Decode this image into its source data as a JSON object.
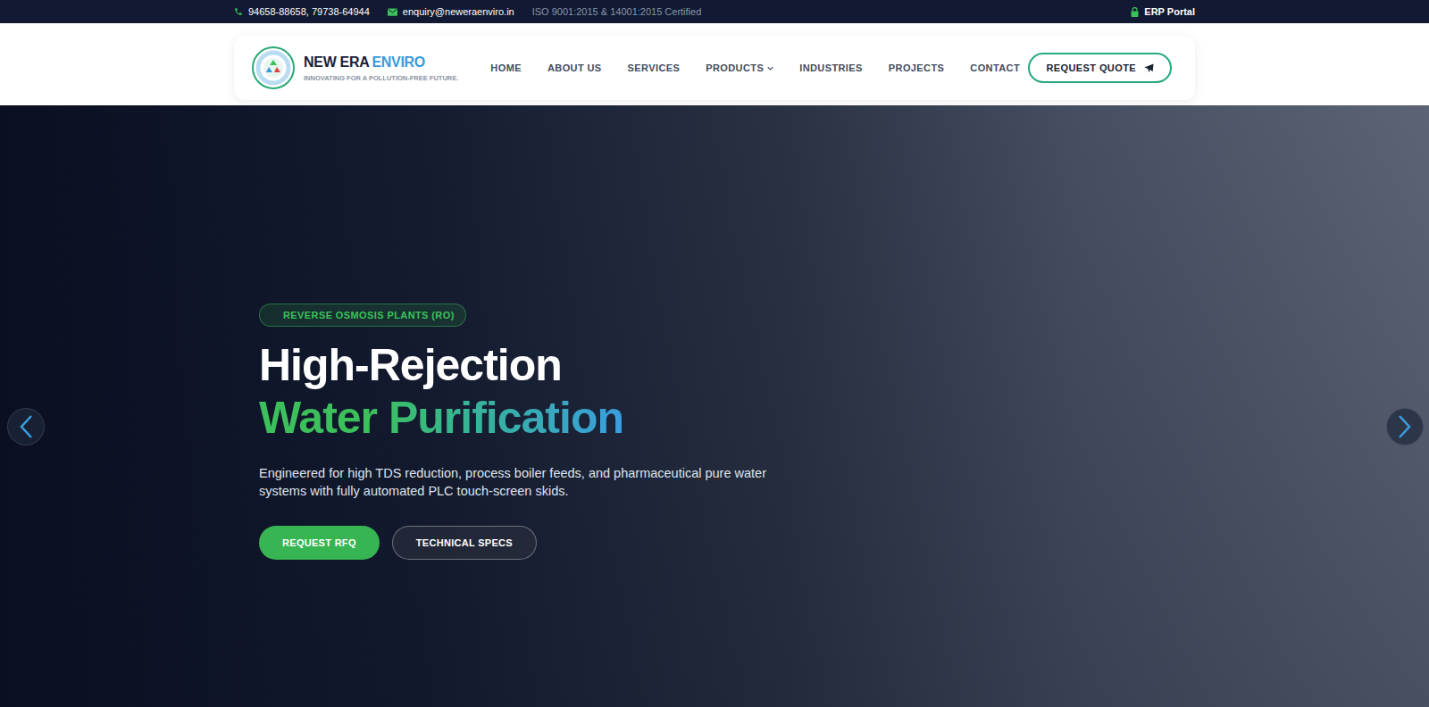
{
  "topbar": {
    "phone": "94658-88658, 79738-64944",
    "email": "enquiry@neweraenviro.in",
    "certification": "ISO 9001:2015 & 14001:2015 Certified",
    "erp_link": "ERP Portal"
  },
  "brand": {
    "name": "NEW ERA",
    "name_accent": "ENVIRO",
    "tagline": "INNOVATING FOR A POLLUTION-FREE FUTURE."
  },
  "nav": {
    "items": [
      {
        "label": "HOME",
        "kind": "link"
      },
      {
        "label": "ABOUT US",
        "kind": "link"
      },
      {
        "label": "SERVICES",
        "kind": "link"
      },
      {
        "label": "PRODUCTS",
        "kind": "dropdown"
      },
      {
        "label": "INDUSTRIES",
        "kind": "link"
      },
      {
        "label": "PROJECTS",
        "kind": "link"
      },
      {
        "label": "CONTACT",
        "kind": "link"
      }
    ]
  },
  "header_button": "REQUEST QUOTE",
  "hero": {
    "badge": "REVERSE OSMOSIS PLANTS (RO)",
    "title_line1": "High-Rejection",
    "title_line2": "Water Purification",
    "description": "Engineered for high TDS reduction, process boiler feeds, and pharmaceutical pure water systems with fully automated PLC touch-screen skids.",
    "buttons": [
      {
        "label": "REQUEST RFQ",
        "kind": "primary"
      },
      {
        "label": "TECHNICAL SPECS",
        "kind": "secondary"
      }
    ]
  }
}
